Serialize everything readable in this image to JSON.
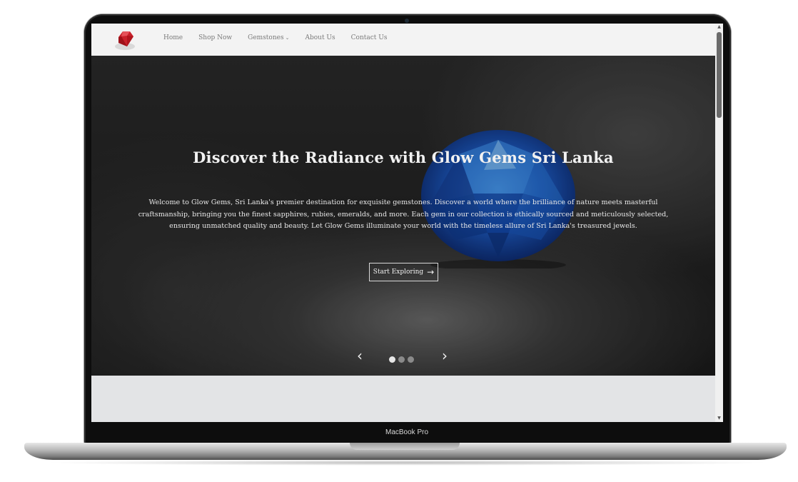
{
  "device": {
    "label": "MacBook Pro"
  },
  "nav": {
    "logo_icon": "red-gem-logo-icon",
    "links": [
      "Home",
      "Shop Now",
      "Gemstones",
      "About Us",
      "Contact Us"
    ],
    "dropdown_caret": "⌄"
  },
  "hero": {
    "title": "Discover the Radiance with Glow Gems Sri Lanka",
    "description": "Welcome to Glow Gems, Sri Lanka's premier destination for exquisite gemstones. Discover a world where the brilliance of nature meets masterful craftsmanship, bringing you the finest sapphires, rubies, emeralds, and more. Each gem in our collection is ethically sourced and meticulously selected, ensuring unmatched quality and beauty. Let Glow Gems illuminate your world with the timeless allure of Sri Lanka's treasured jewels.",
    "cta_label": "Start Exploring",
    "cta_arrow": "→",
    "prev_glyph": "‹",
    "next_glyph": "›",
    "slides_count": 3,
    "active_slide": 1
  },
  "colors": {
    "frame": "#0d0d0d",
    "navbar_bg": "#f3f3f3",
    "nav_text": "#7a7a7a",
    "hero_text": "#f1f1f1",
    "gem_blue": "#1f5fc8",
    "logo_red": "#c8202a"
  }
}
